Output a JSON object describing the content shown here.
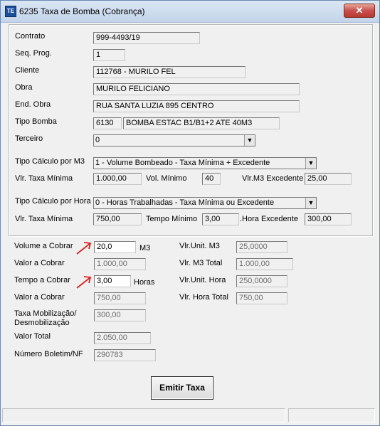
{
  "window": {
    "title": "6235 Taxa de Bomba (Cobrança)",
    "icon_text": "TE",
    "close_symbol": "✕"
  },
  "form": {
    "contrato_label": "Contrato",
    "contrato": "999-4493/19",
    "seq_label": "Seq. Prog.",
    "seq": "1",
    "cliente_label": "Cliente",
    "cliente": "112768 - MURILO FEL",
    "obra_label": "Obra",
    "obra": "MURILO FELICIANO",
    "end_label": "End. Obra",
    "end": "RUA SANTA LUZIA 895  CENTRO",
    "bomba_label": "Tipo Bomba",
    "bomba_code": "6130",
    "bomba_desc": "BOMBA ESTAC B1/B1+2 ATE 40M3",
    "terceiro_label": "Terceiro",
    "terceiro": "0",
    "calc_m3_label": "Tipo Cálculo por M3",
    "calc_m3": "1 - Volume Bombeado - Taxa Mínima + Excedente",
    "vlr_taxa_min1_label": "Vlr. Taxa Mínima",
    "vlr_taxa_min1": "1.000,00",
    "vol_min_label": "Vol. Mínimo",
    "vol_min": "40",
    "vlr_m3_exc_label": "Vlr.M3 Excedente",
    "vlr_m3_exc": "25,00",
    "calc_hora_label": "Tipo Cálculo por Hora",
    "calc_hora": "0 - Horas Trabalhadas - Taxa Mínima ou Excedente",
    "vlr_taxa_min2_label": "Vlr. Taxa Mínima",
    "vlr_taxa_min2": "750,00",
    "tempo_min_label": "Tempo Mínimo",
    "tempo_min": "3,00",
    "hora_exc_label": ".Hora Excedente",
    "hora_exc": "300,00"
  },
  "billing": {
    "volume_label": "Volume a Cobrar",
    "volume": "20,0",
    "volume_unit": "M3",
    "valor1_label": "Valor a Cobrar",
    "valor1": "1.000,00",
    "tempo_label": "Tempo a Cobrar",
    "tempo": "3,00",
    "tempo_unit": "Horas",
    "valor2_label": "Valor a Cobrar",
    "valor2": "750,00",
    "taxa_mob_label1": "Taxa Mobilização/",
    "taxa_mob_label2": "Desmobilização",
    "taxa_mob": "300,00",
    "valor_total_label": "Valor Total",
    "valor_total": "2.050,00",
    "boletim_label": "Número Boletim/NF",
    "boletim": "290783",
    "unit_m3_label": "Vlr.Unit. M3",
    "unit_m3": "25,0000",
    "m3_total_label": "Vlr. M3 Total",
    "m3_total": "1.000,00",
    "unit_hora_label": "Vlr.Unit. Hora",
    "unit_hora": "250,0000",
    "hora_total_label": "Vlr. Hora Total",
    "hora_total": "750,00"
  },
  "actions": {
    "emitir_label": "Emitir Taxa"
  },
  "colors": {
    "annotation_arrow": "#e02020"
  }
}
